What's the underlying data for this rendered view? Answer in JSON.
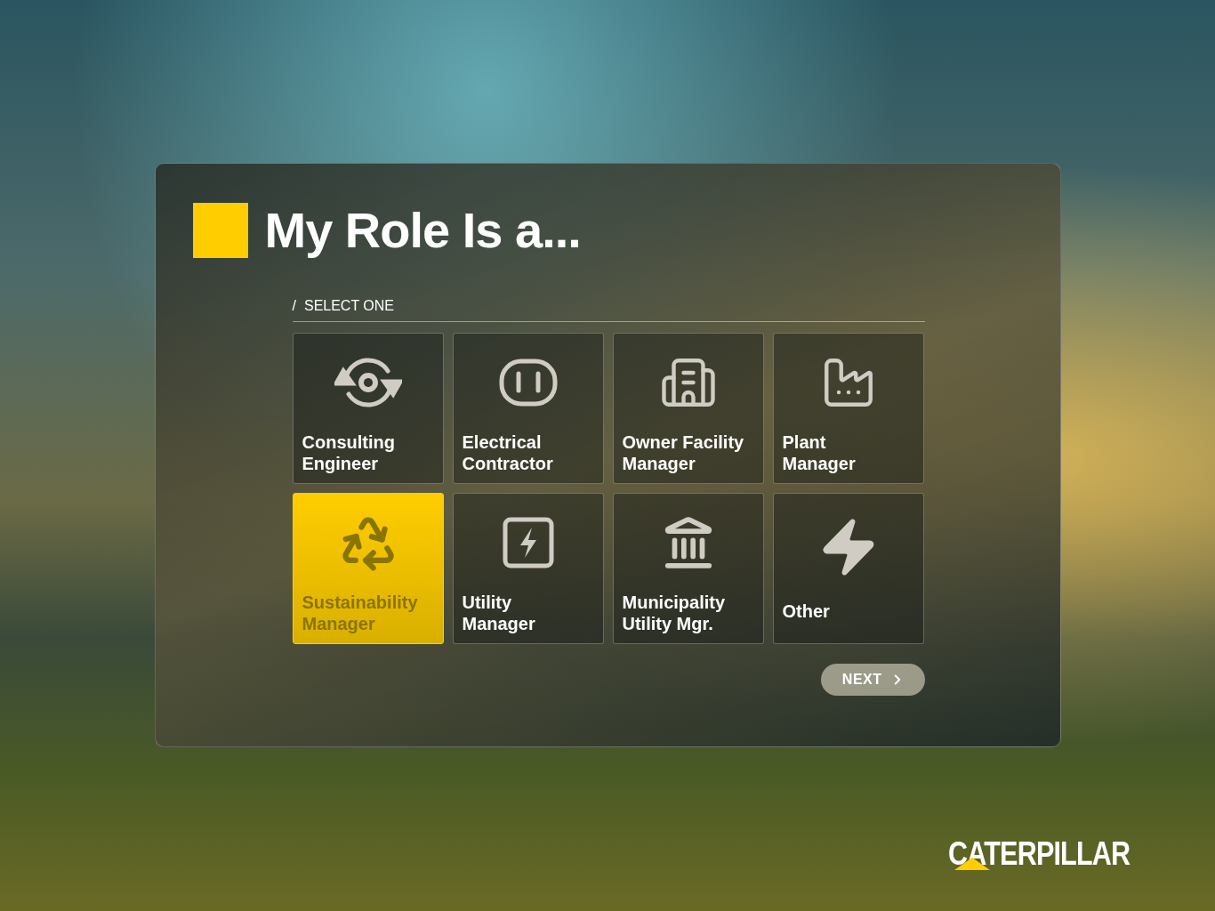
{
  "title": "My Role Is a...",
  "section": {
    "slash": "/",
    "label": "SELECT ONE"
  },
  "roles": [
    {
      "label": "Consulting Engineer",
      "selected": false
    },
    {
      "label": "Electrical Contractor",
      "selected": false
    },
    {
      "label": "Owner Facility Manager",
      "selected": false
    },
    {
      "label": "Plant\nManager",
      "selected": false
    },
    {
      "label": "Sustainability Manager",
      "selected": true
    },
    {
      "label": "Utility\nManager",
      "selected": false
    },
    {
      "label": "Municipality Utility Mgr.",
      "selected": false
    },
    {
      "label": "Other",
      "selected": false
    }
  ],
  "next_button": {
    "label": "NEXT"
  },
  "brand": "CATERPILLAR"
}
